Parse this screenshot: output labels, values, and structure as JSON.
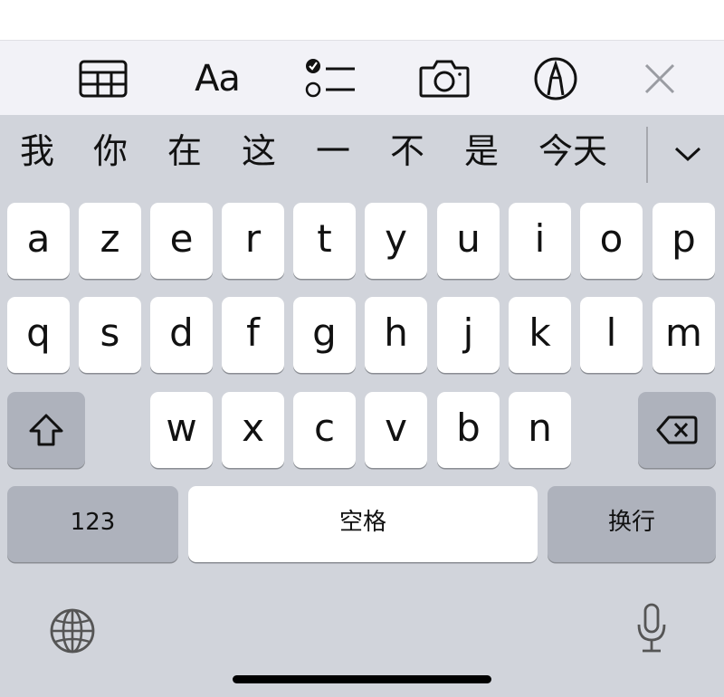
{
  "toolbar": {
    "format_label": "Aa",
    "buttons": [
      "table-icon",
      "text-format-button",
      "checklist-icon",
      "camera-icon",
      "markup-icon",
      "close-icon"
    ]
  },
  "candidates": {
    "items": [
      "我",
      "你",
      "在",
      "这",
      "一",
      "不",
      "是",
      "今天"
    ],
    "expand_icon": "chevron-down-icon"
  },
  "keyboard": {
    "row1": [
      "a",
      "z",
      "e",
      "r",
      "t",
      "y",
      "u",
      "i",
      "o",
      "p"
    ],
    "row2": [
      "q",
      "s",
      "d",
      "f",
      "g",
      "h",
      "j",
      "k",
      "l",
      "m"
    ],
    "row3": [
      "w",
      "x",
      "c",
      "v",
      "b",
      "n"
    ],
    "numbers_label": "123",
    "space_label": "空格",
    "return_label": "换行",
    "shift_icon": "shift-icon",
    "delete_icon": "delete-icon"
  },
  "bottom": {
    "globe_icon": "globe-icon",
    "mic_icon": "microphone-icon"
  },
  "colors": {
    "keyboard_bg": "#d1d4db",
    "key_bg": "#ffffff",
    "func_key_bg": "#aeb2bc",
    "toolbar_bg": "#f2f2f7"
  }
}
